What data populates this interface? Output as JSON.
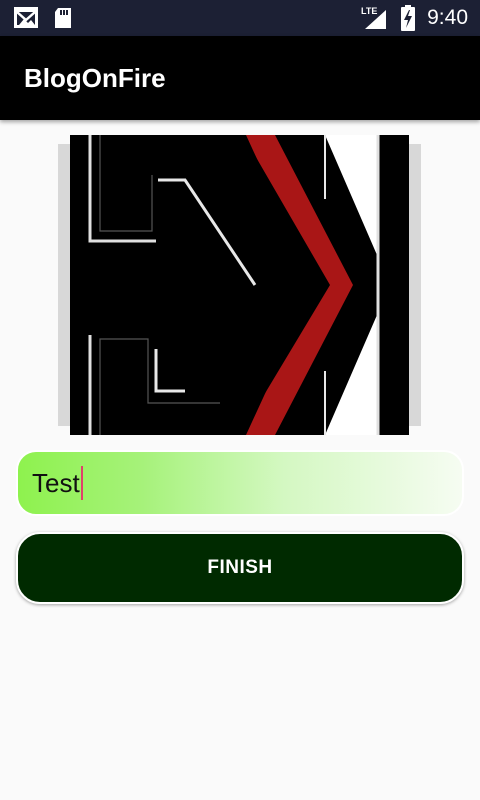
{
  "status_bar": {
    "time": "9:40",
    "network": "LTE",
    "icons": [
      "gmail-icon",
      "sd-card-icon",
      "signal-icon",
      "battery-charging-icon"
    ]
  },
  "app_bar": {
    "title": "BlogOnFire"
  },
  "form": {
    "title_value": "Test",
    "finish_label": "FINISH",
    "accent_colors": {
      "button": "#002a00",
      "field_start": "#8ef24e",
      "logo_red": "#a91616"
    }
  }
}
